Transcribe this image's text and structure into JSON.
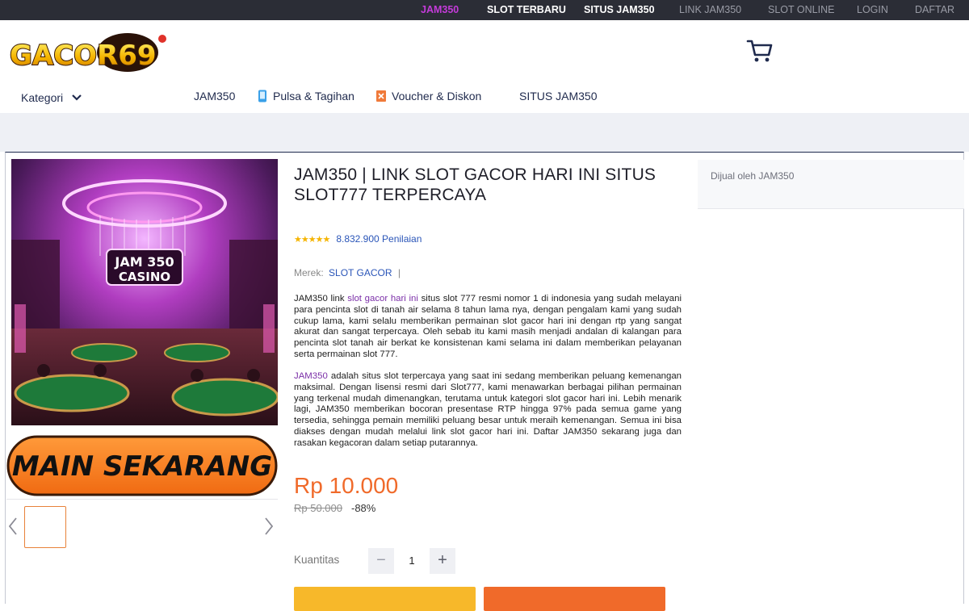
{
  "topnav": [
    {
      "label": "JAM350",
      "style": "active"
    },
    {
      "label": "SLOT TERBARU",
      "style": "bold"
    },
    {
      "label": "SITUS JAM350",
      "style": "bold"
    },
    {
      "label": "LINK JAM350",
      "style": "plain"
    },
    {
      "label": "SLOT ONLINE",
      "style": "plain"
    },
    {
      "label": "LOGIN",
      "style": "plain"
    },
    {
      "label": "DAFTAR",
      "style": "plain"
    }
  ],
  "logo": {
    "text": "GACOR69"
  },
  "nav": {
    "kategori": "Kategori",
    "links": [
      {
        "label": "JAM350",
        "icon": ""
      },
      {
        "label": "Pulsa & Tagihan",
        "icon": "phone-icon"
      },
      {
        "label": "Voucher & Diskon",
        "icon": "voucher-icon"
      },
      {
        "label": "SITUS JAM350",
        "icon": ""
      }
    ]
  },
  "gallery": {
    "image_sign": [
      "JAM 350",
      "CASINO"
    ],
    "cta_label": "MAIN SEKARANG"
  },
  "product": {
    "title": "JAM350 | LINK SLOT GACOR HARI INI SITUS SLOT777 TERPERCAYA",
    "stars": "★★★★★",
    "rating_count": "8.832.900 Penilaian",
    "brand_label": "Merek:",
    "brand_value": "SLOT GACOR",
    "brand_sep": "|",
    "desc1_a": "JAM350 link ",
    "desc1_link": "slot gacor hari ini",
    "desc1_b": " situs slot 777 resmi nomor 1 di indonesia yang sudah melayani para pencinta slot di tanah air selama 8 tahun lama nya, dengan pengalam kami yang sudah cukup lama, kami selalu memberikan permainan slot gacor hari ini dengan rtp yang sangat akurat dan sangat terpercaya. Oleh sebab itu kami masih menjadi andalan di kalangan para pencinta slot tanah air berkat ke konsistenan kami selama ini dalam memberikan pelayanan serta permainan slot 777.",
    "desc2_link": "JAM350",
    "desc2_b": " adalah situs slot terpercaya yang saat ini sedang memberikan peluang kemenangan maksimal. Dengan lisensi resmi dari Slot777, kami menawarkan berbagai pilihan permainan yang terkenal mudah dimenangkan, terutama untuk kategori slot gacor hari ini. Lebih menarik lagi, JAM350 memberikan bocoran presentase RTP hingga 97% pada semua game yang tersedia, sehingga pemain memiliki peluang besar untuk meraih kemenangan. Semua ini bisa diakses dengan mudah melalui link slot gacor hari ini. Daftar JAM350 sekarang juga dan rasakan kegacoran dalam setiap putarannya.",
    "price": "Rp 10.000",
    "old_price": "Rp 50.000",
    "discount": "-88%",
    "qty_label": "Kuantitas",
    "qty_minus": "−",
    "qty_plus": "+",
    "qty_value": "1"
  },
  "seller": {
    "text": "Dijual oleh JAM350"
  },
  "colors": {
    "accent": "#f06a2a",
    "link": "#2a55b8",
    "topbar": "#2b2d36",
    "active": "#c43bd9"
  }
}
